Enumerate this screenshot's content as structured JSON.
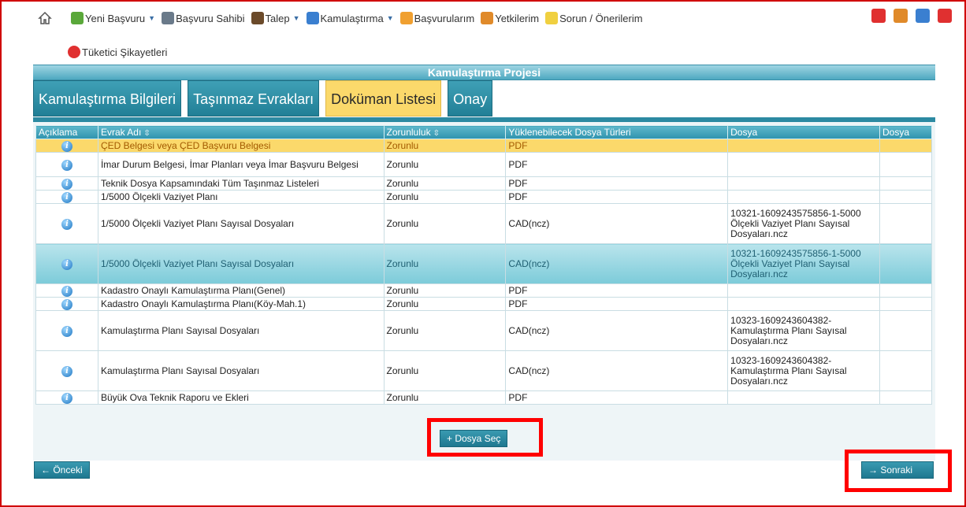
{
  "nav": {
    "row1": [
      {
        "label": "Yeni Başvuru",
        "icon": "new-application-icon",
        "color": "#5aa83a",
        "dropdown": true
      },
      {
        "label": "Başvuru Sahibi",
        "icon": "applicant-icon",
        "color": "#6a7a8a",
        "dropdown": false
      },
      {
        "label": "Talep",
        "icon": "request-icon",
        "color": "#6b4a2a",
        "dropdown": true
      },
      {
        "label": "Kamulaştırma",
        "icon": "globe-icon",
        "color": "#3a7fd0",
        "dropdown": true
      },
      {
        "label": "Başvurularım",
        "icon": "my-applications-icon",
        "color": "#f0a030",
        "dropdown": false
      },
      {
        "label": "Yetkilerim",
        "icon": "permissions-icon",
        "color": "#e08a2a",
        "dropdown": false
      },
      {
        "label": "Sorun / Önerilerim",
        "icon": "suggestion-icon",
        "color": "#f0d040",
        "dropdown": false
      }
    ],
    "row2": [
      {
        "label": "Tüketici Şikayetleri",
        "icon": "complaint-icon",
        "color": "#e03030"
      }
    ],
    "right_icons": [
      {
        "name": "notification-icon",
        "color": "#e03030"
      },
      {
        "name": "user-profile-icon",
        "color": "#e08a2a"
      },
      {
        "name": "help-icon",
        "color": "#3a7fd0"
      },
      {
        "name": "power-off-icon",
        "color": "#e03030"
      }
    ]
  },
  "page": {
    "title": "Kamulaştırma Projesi"
  },
  "tabs": [
    {
      "label": "Kamulaştırma Bilgileri",
      "active": false
    },
    {
      "label": "Taşınmaz Evrakları",
      "active": false
    },
    {
      "label": "Doküman Listesi",
      "active": true
    },
    {
      "label": "Onay",
      "active": false
    }
  ],
  "table": {
    "headers": [
      "Açıklama",
      "Evrak Adı",
      "Zorunluluk",
      "Yüklenebilecek Dosya Türleri",
      "Dosya",
      "Dosya"
    ],
    "rows": [
      {
        "name": "ÇED Belgesi veya ÇED Başvuru Belgesi",
        "req": "Zorunlu",
        "types": "PDF",
        "file": "",
        "style": "hl"
      },
      {
        "name": "İmar Durum Belgesi, İmar Planları veya İmar Başvuru Belgesi",
        "req": "Zorunlu",
        "types": "PDF",
        "file": "",
        "style": ""
      },
      {
        "name": "Teknik Dosya Kapsamındaki Tüm Taşınmaz Listeleri",
        "req": "Zorunlu",
        "types": "PDF",
        "file": "",
        "style": ""
      },
      {
        "name": "1/5000 Ölçekli Vaziyet Planı",
        "req": "Zorunlu",
        "types": "PDF",
        "file": "",
        "style": ""
      },
      {
        "name": "1/5000 Ölçekli Vaziyet Planı Sayısal Dosyaları",
        "req": "Zorunlu",
        "types": "CAD(ncz)",
        "file": "10321-1609243575856-1-5000 Ölçekli Vaziyet Planı Sayısal Dosyaları.ncz",
        "style": ""
      },
      {
        "name": "1/5000 Ölçekli Vaziyet Planı Sayısal Dosyaları",
        "req": "Zorunlu",
        "types": "CAD(ncz)",
        "file": "10321-1609243575856-1-5000 Ölçekli Vaziyet Planı Sayısal Dosyaları.ncz",
        "style": "sel"
      },
      {
        "name": "Kadastro Onaylı Kamulaştırma Planı(Genel)",
        "req": "Zorunlu",
        "types": "PDF",
        "file": "",
        "style": ""
      },
      {
        "name": "Kadastro Onaylı Kamulaştırma Planı(Köy-Mah.1)",
        "req": "Zorunlu",
        "types": "PDF",
        "file": "",
        "style": ""
      },
      {
        "name": "Kamulaştırma Planı Sayısal Dosyaları",
        "req": "Zorunlu",
        "types": "CAD(ncz)",
        "file": "10323-1609243604382-Kamulaştırma Planı Sayısal Dosyaları.ncz",
        "style": ""
      },
      {
        "name": "Kamulaştırma Planı Sayısal Dosyaları",
        "req": "Zorunlu",
        "types": "CAD(ncz)",
        "file": "10323-1609243604382-Kamulaştırma Planı Sayısal Dosyaları.ncz",
        "style": ""
      },
      {
        "name": "Büyük Ova Teknik Raporu ve Ekleri",
        "req": "Zorunlu",
        "types": "PDF",
        "file": "",
        "style": ""
      }
    ]
  },
  "buttons": {
    "choose_file": "+ Dosya Seç",
    "previous": "← Önceki",
    "next": "→ Sonraki"
  },
  "colors": {
    "accent": "#2c8aa2",
    "highlight": "#fbd96b",
    "annotation": "#ff0000"
  }
}
